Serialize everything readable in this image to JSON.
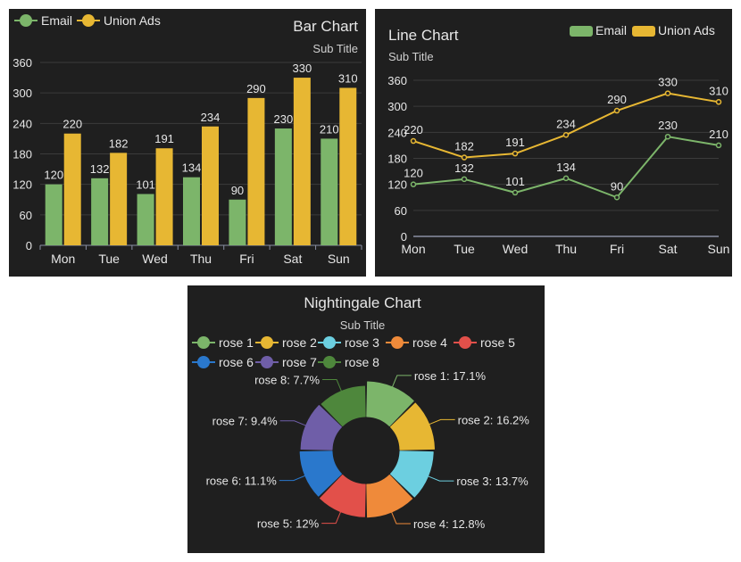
{
  "colors": {
    "panel_bg": "#1f1f1f",
    "text": "#e6e6e6",
    "sub_text": "#cfcfcf",
    "grid": "#3b3b3b",
    "axis": "#8a8fa3",
    "email": "#7cb56a",
    "union": "#e7b733"
  },
  "chart_data": [
    {
      "type": "bar",
      "title": "Bar Chart",
      "subtitle": "Sub Title",
      "categories": [
        "Mon",
        "Tue",
        "Wed",
        "Thu",
        "Fri",
        "Sat",
        "Sun"
      ],
      "series": [
        {
          "name": "Email",
          "values": [
            120,
            132,
            101,
            134,
            90,
            230,
            210
          ],
          "color": "#7cb56a"
        },
        {
          "name": "Union Ads",
          "values": [
            220,
            182,
            191,
            234,
            290,
            330,
            310
          ],
          "color": "#e7b733"
        }
      ],
      "yticks": [
        0,
        60,
        120,
        180,
        240,
        300,
        360
      ],
      "ylim": [
        0,
        360
      ],
      "grid": true,
      "legend_position": "top-left",
      "data_labels": true
    },
    {
      "type": "line",
      "title": "Line Chart",
      "subtitle": "Sub Title",
      "categories": [
        "Mon",
        "Tue",
        "Wed",
        "Thu",
        "Fri",
        "Sat",
        "Sun"
      ],
      "series": [
        {
          "name": "Email",
          "values": [
            120,
            132,
            101,
            134,
            90,
            230,
            210
          ],
          "color": "#7cb56a"
        },
        {
          "name": "Union Ads",
          "values": [
            220,
            182,
            191,
            234,
            290,
            330,
            310
          ],
          "color": "#e7b733"
        }
      ],
      "yticks": [
        0,
        60,
        120,
        180,
        240,
        300,
        360
      ],
      "ylim": [
        0,
        360
      ],
      "grid": true,
      "legend_position": "top-right",
      "data_labels": true
    },
    {
      "type": "pie",
      "variant": "nightingale-rose",
      "title": "Nightingale Chart",
      "subtitle": "Sub Title",
      "legend_position": "top-left",
      "slices": [
        {
          "name": "rose 1",
          "label": "rose 1: 17.1%",
          "value": 17.1,
          "color": "#7cb56a"
        },
        {
          "name": "rose 2",
          "label": "rose 2: 16.2%",
          "value": 16.2,
          "color": "#e7b733"
        },
        {
          "name": "rose 3",
          "label": "rose 3: 13.7%",
          "value": 13.7,
          "color": "#6ccfe0"
        },
        {
          "name": "rose 4",
          "label": "rose 4: 12.8%",
          "value": 12.8,
          "color": "#ef8a3a"
        },
        {
          "name": "rose 5",
          "label": "rose 5: 12%",
          "value": 12.0,
          "color": "#e2504a"
        },
        {
          "name": "rose 6",
          "label": "rose 6: 11.1%",
          "value": 11.1,
          "color": "#2a78cc"
        },
        {
          "name": "rose 7",
          "label": "rose 7: 9.4%",
          "value": 9.4,
          "color": "#6f5ea8"
        },
        {
          "name": "rose 8",
          "label": "rose 8: 7.7%",
          "value": 7.7,
          "color": "#4e873c"
        }
      ]
    }
  ]
}
